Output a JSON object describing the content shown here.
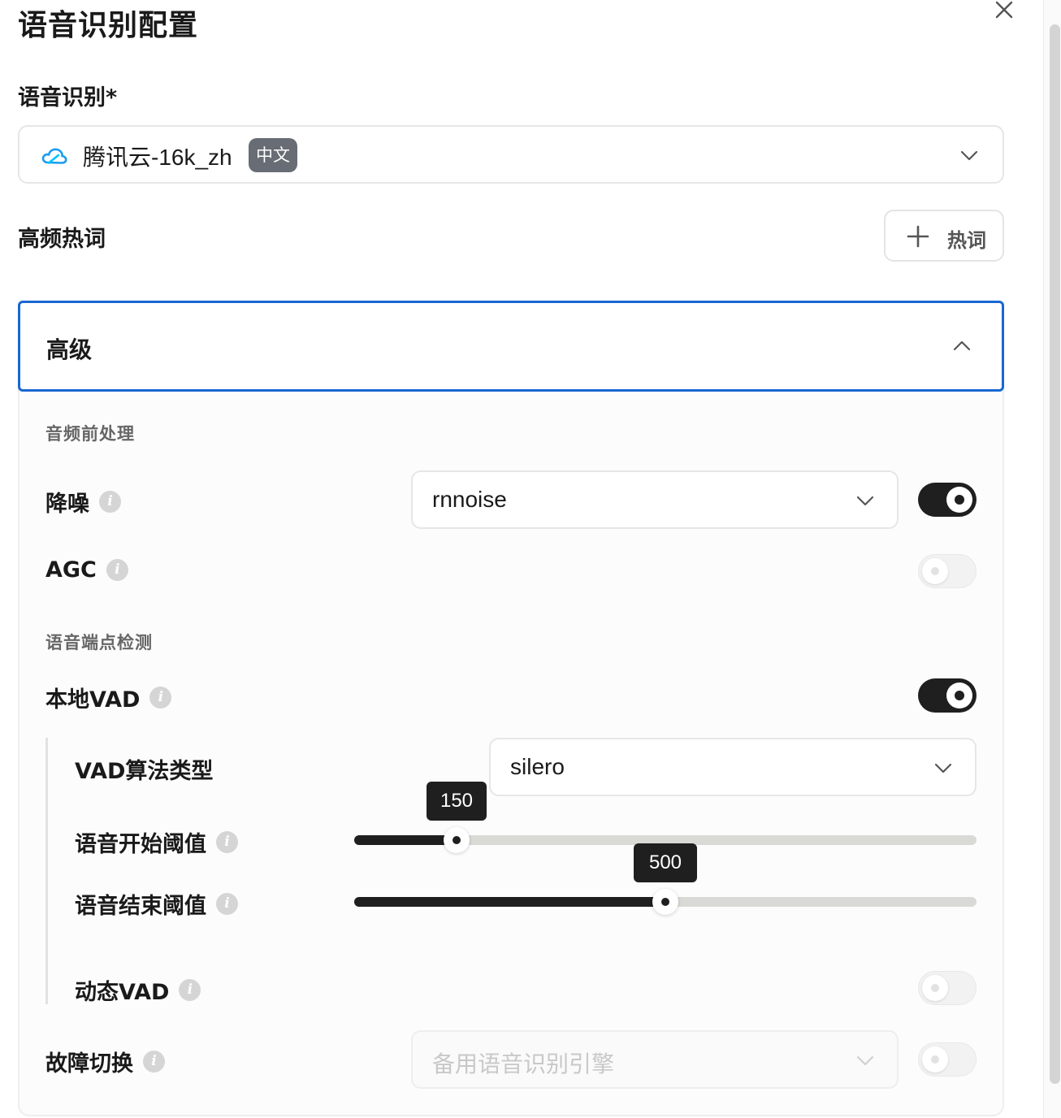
{
  "dialog": {
    "title": "语音识别配置"
  },
  "asr": {
    "label": "语音识别*",
    "selected_value": "腾讯云-16k_zh",
    "language_badge": "中文",
    "icon": "cloud-icon"
  },
  "hotwords": {
    "label": "高频热词",
    "add_button_label": "热词"
  },
  "advanced": {
    "header": "高级",
    "expanded": true,
    "audio_preprocessing": {
      "section_title": "音频前处理",
      "noise_reduction": {
        "label": "降噪",
        "value": "rnnoise",
        "enabled": true
      },
      "agc": {
        "label": "AGC",
        "enabled": false
      }
    },
    "vad": {
      "section_title": "语音端点检测",
      "local_vad": {
        "label": "本地VAD",
        "enabled": true
      },
      "algorithm": {
        "label": "VAD算法类型",
        "value": "silero"
      },
      "start_threshold": {
        "label": "语音开始阈值",
        "value": "150",
        "fill_fraction": 0.165
      },
      "end_threshold": {
        "label": "语音结束阈值",
        "value": "500",
        "fill_fraction": 0.5
      },
      "dynamic_vad": {
        "label": "动态VAD",
        "enabled": false
      }
    },
    "failover": {
      "label": "故障切换",
      "placeholder": "备用语音识别引擎",
      "enabled": false
    }
  },
  "colors": {
    "accent_border": "#1967d2",
    "toggle_on": "#1f1f1f",
    "badge_bg": "#686c74",
    "cloud_icon": "#1a9cf0"
  }
}
